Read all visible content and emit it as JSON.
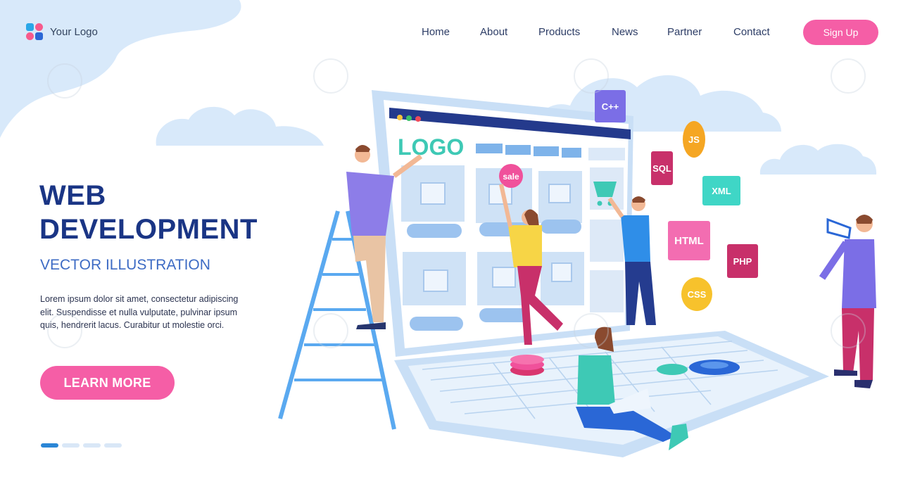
{
  "brand": {
    "name": "Your Logo",
    "logo_icon": "four-petal-logo-icon"
  },
  "nav": {
    "items": [
      {
        "label": "Home"
      },
      {
        "label": "About"
      },
      {
        "label": "Products"
      },
      {
        "label": "News"
      },
      {
        "label": "Partner"
      },
      {
        "label": "Contact"
      }
    ],
    "signup_label": "Sign Up"
  },
  "hero": {
    "title_line1": "WEB",
    "title_line2": "DEVELOPMENT",
    "subtitle": "VECTOR ILLUSTRATION",
    "body": "Lorem ipsum dolor sit amet, consectetur adipiscing elit. Suspendisse et nulla vulputate, pulvinar ipsum quis, hendrerit lacus. Curabitur ut molestie orci.",
    "cta_label": "LEARN MORE"
  },
  "slider": {
    "count": 4,
    "active_index": 0
  },
  "illustration": {
    "screen_logo": "LOGO",
    "sale_sticker": "sale",
    "tech_badges": [
      {
        "label": "C++",
        "color": "#7b6ee6"
      },
      {
        "label": "JS",
        "color": "#f5a623"
      },
      {
        "label": "SQL",
        "color": "#c8306a"
      },
      {
        "label": "XML",
        "color": "#3fd6c6"
      },
      {
        "label": "HTML",
        "color": "#f36db1"
      },
      {
        "label": "PHP",
        "color": "#c8306a"
      },
      {
        "label": "CSS",
        "color": "#f7c22c"
      }
    ]
  },
  "colors": {
    "accent_pink": "#f55ea6",
    "title_navy": "#1a3585",
    "subtitle_blue": "#3d6bc4",
    "sky_blue": "#d8e9fa"
  }
}
